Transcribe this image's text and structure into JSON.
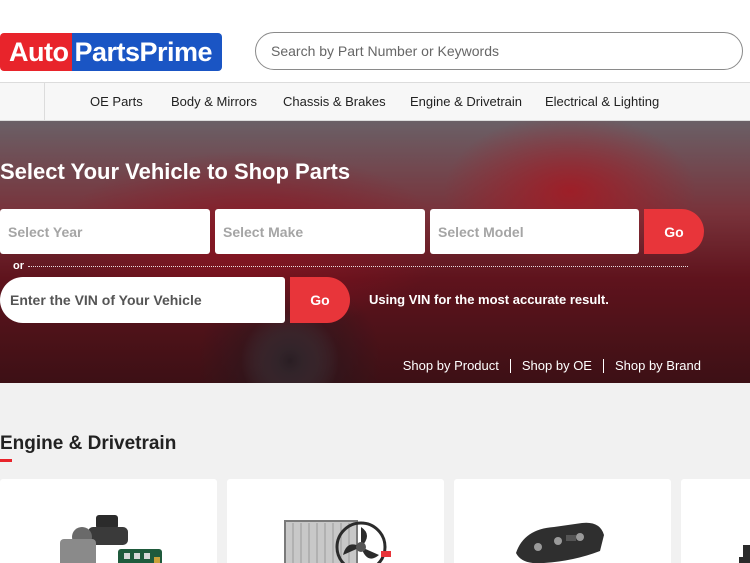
{
  "header": {
    "logo_part1": "Auto",
    "logo_part2": "PartsPrime",
    "search_placeholder": "Search by Part Number or Keywords"
  },
  "nav": {
    "items": [
      {
        "label": "OE Parts"
      },
      {
        "label": "Body & Mirrors"
      },
      {
        "label": "Chassis & Brakes"
      },
      {
        "label": "Engine & Drivetrain"
      },
      {
        "label": "Electrical & Lighting"
      }
    ]
  },
  "hero": {
    "title": "Select Your Vehicle to Shop Parts",
    "year_placeholder": "Select Year",
    "make_placeholder": "Select Make",
    "model_placeholder": "Select Model",
    "go_label": "Go",
    "or_label": "or",
    "vin_placeholder": "Enter the VIN of Your Vehicle",
    "vin_go_label": "Go",
    "vin_note": "Using VIN for the most accurate result.",
    "links": [
      {
        "label": "Shop by Product"
      },
      {
        "label": "Shop by OE"
      },
      {
        "label": "Shop by Brand"
      }
    ]
  },
  "section": {
    "title": "Engine & Drivetrain",
    "cards": [
      {
        "icon": "distributor-icon"
      },
      {
        "icon": "radiator-icon"
      },
      {
        "icon": "valve-cover-icon"
      },
      {
        "icon": "engine-part-icon"
      }
    ]
  },
  "colors": {
    "brand_red": "#e8242b",
    "brand_blue": "#1a55c4",
    "button_red": "#e8353a"
  }
}
